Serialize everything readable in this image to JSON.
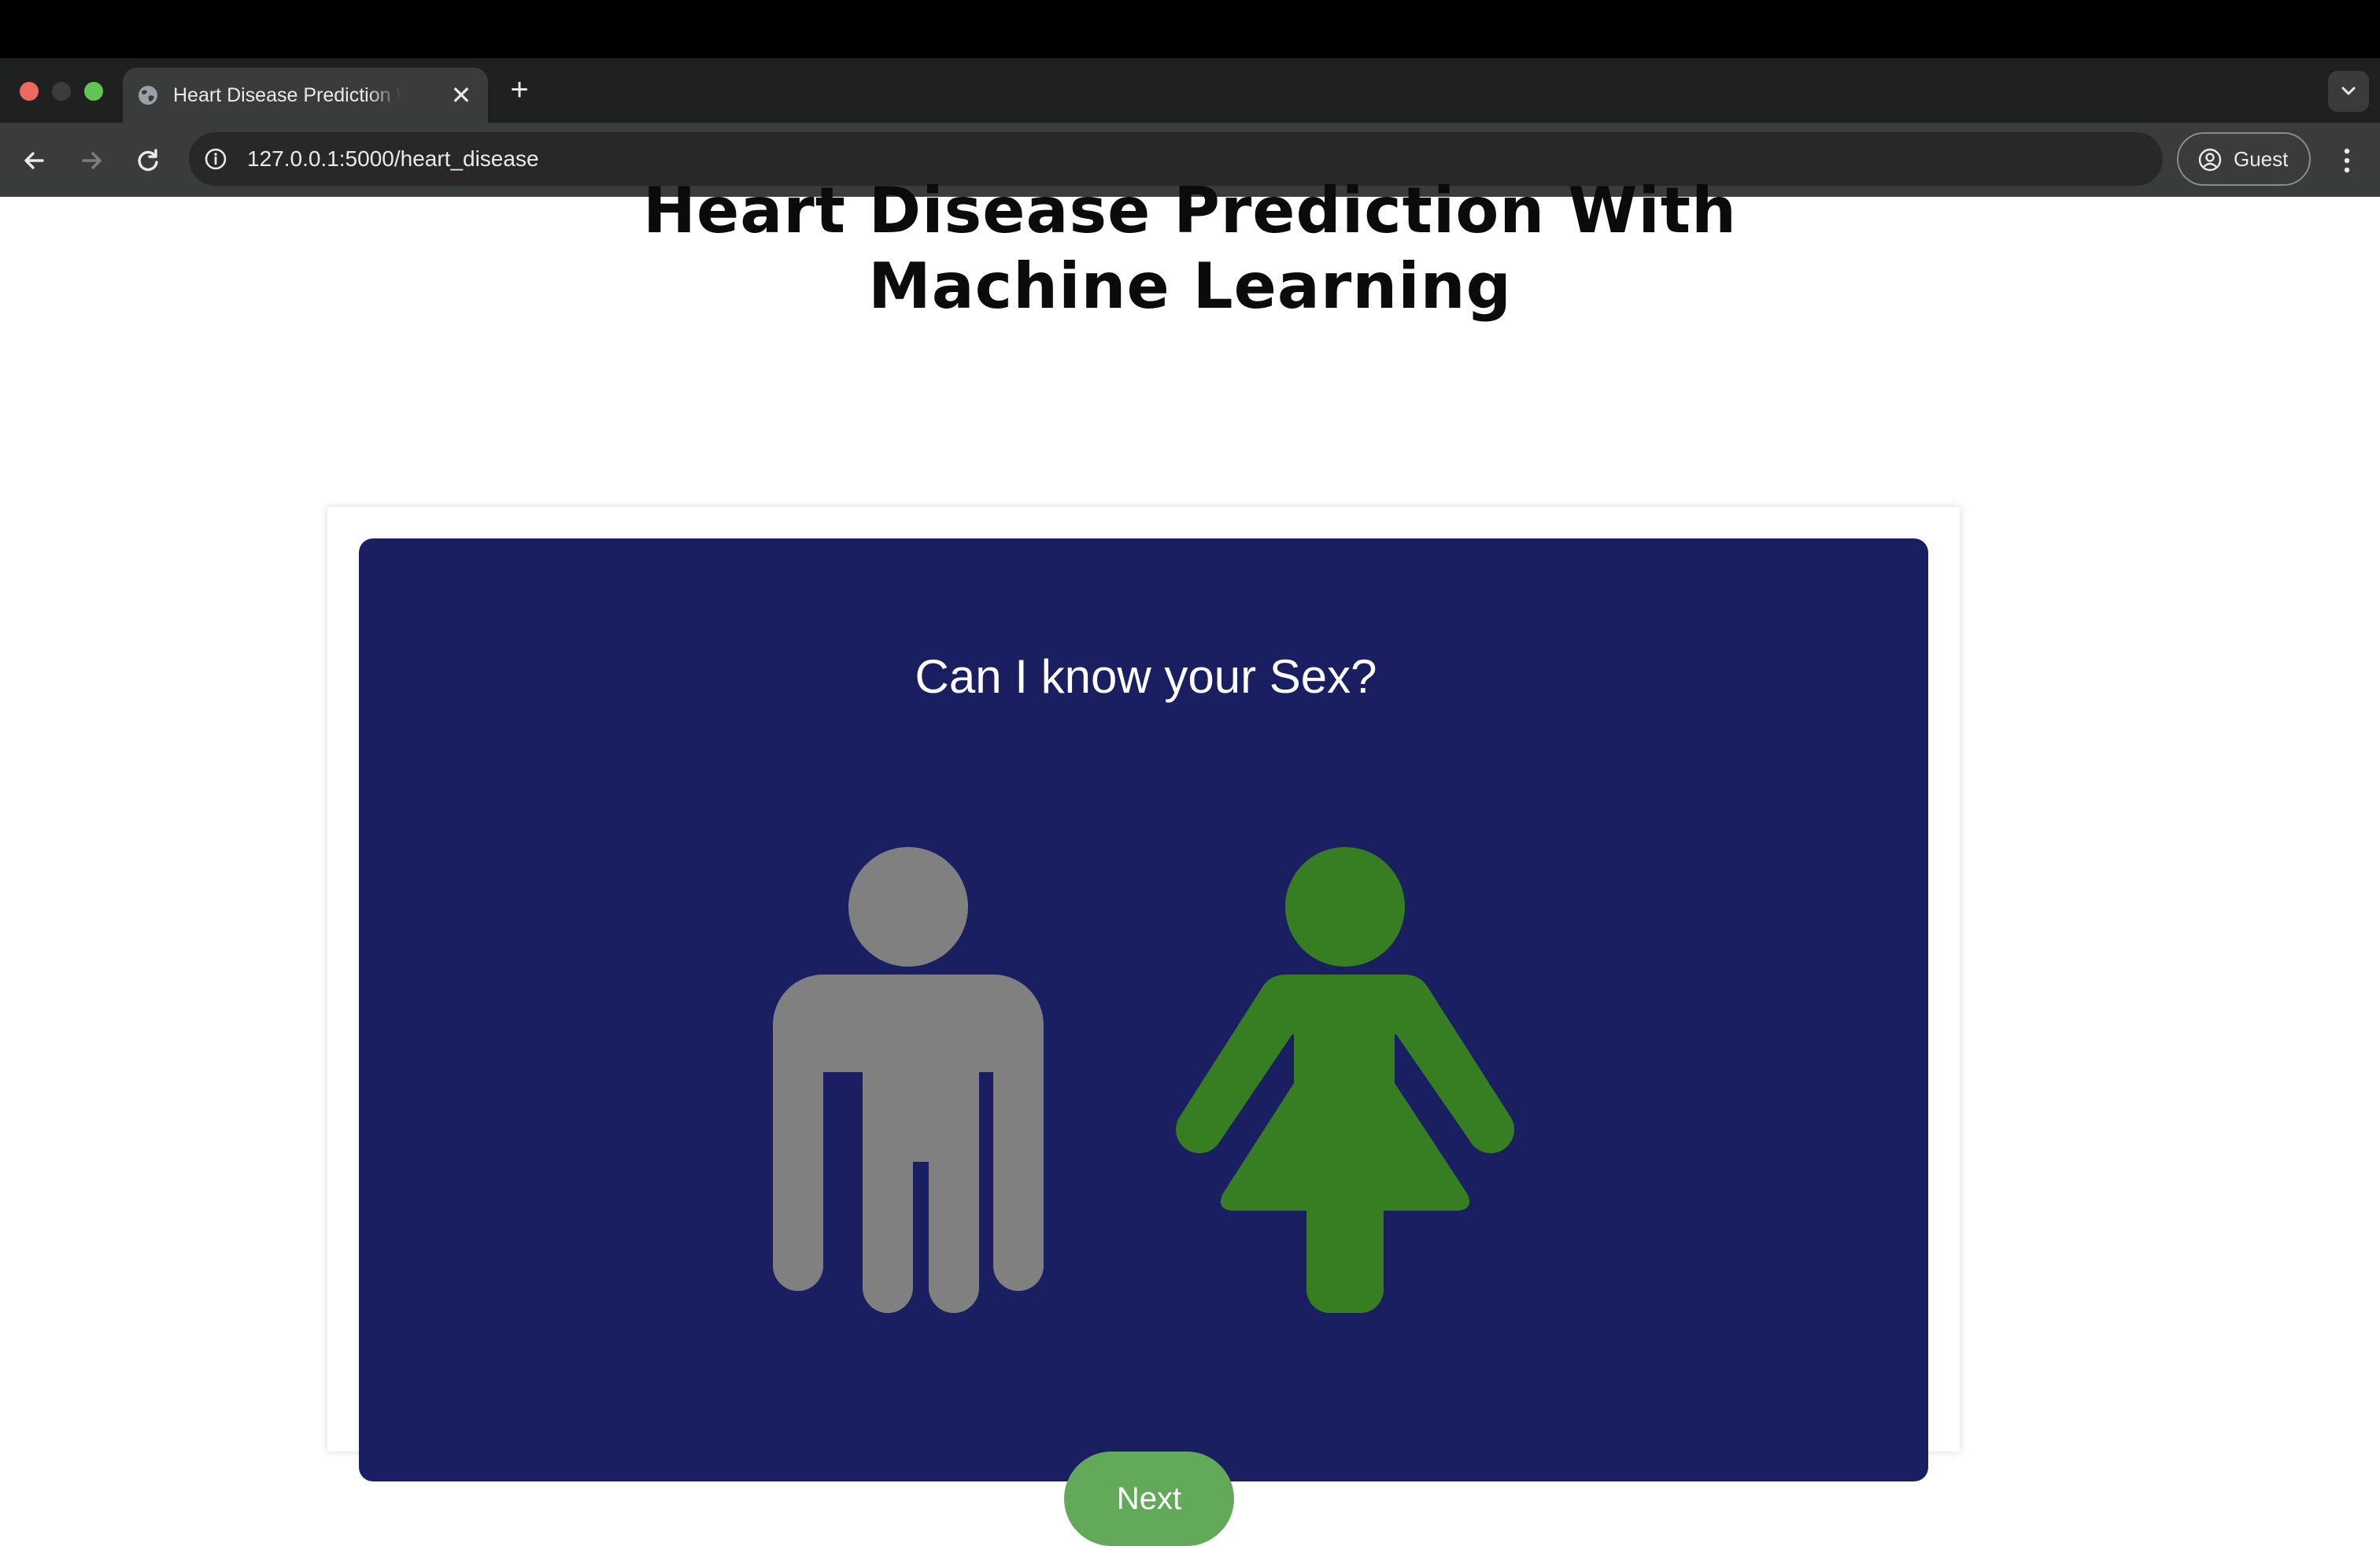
{
  "browser": {
    "tab_title": "Heart Disease Prediction With Machine Learning",
    "address": "127.0.0.1:5000/heart_disease",
    "profile_label": "Guest",
    "icons": [
      "globe-icon",
      "close-icon",
      "plus-icon",
      "chevron-down-icon",
      "back-arrow-icon",
      "forward-arrow-icon",
      "reload-icon",
      "info-icon",
      "profile-icon",
      "kebab-menu-icon"
    ]
  },
  "page": {
    "title_line1": "Heart Disease Prediction With",
    "title_line2": "Machine Learning",
    "question": "Can I know your Sex?",
    "options": [
      {
        "name": "male",
        "icon": "male-figure-icon",
        "color": "#808080",
        "selected": false
      },
      {
        "name": "female",
        "icon": "female-figure-icon",
        "color": "#377d22",
        "selected": true
      }
    ],
    "next_label": "Next"
  },
  "colors": {
    "card_background": "#1a1f61",
    "next_button": "#62a95a",
    "chrome_tab": "#3a3b3b",
    "chrome_strip": "#1f2020"
  }
}
